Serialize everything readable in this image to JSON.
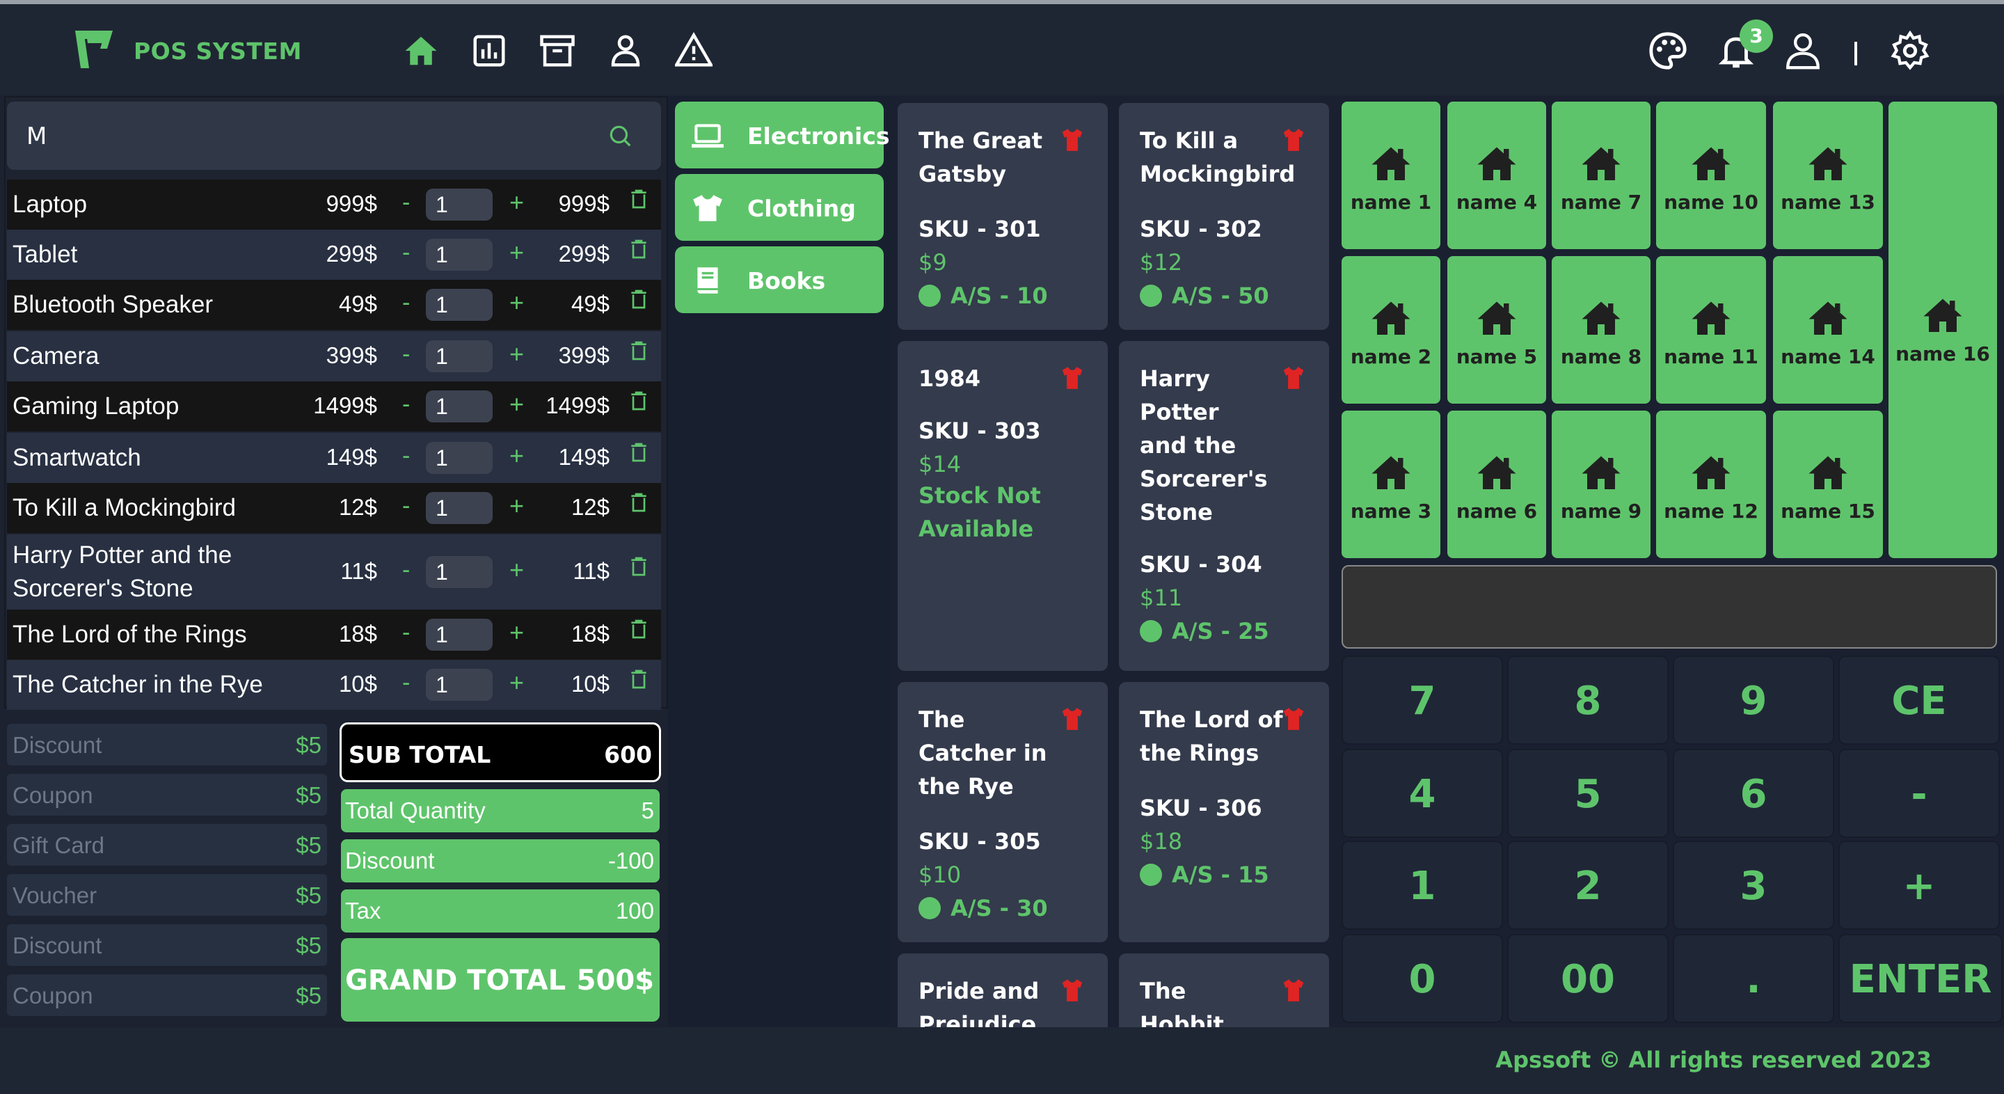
{
  "header": {
    "brand": "POS SYSTEM",
    "notification_count": "3"
  },
  "nav_icons": [
    "home-icon",
    "chart-icon",
    "archive-icon",
    "user-icon",
    "warning-icon"
  ],
  "right_icons": [
    "palette-icon",
    "bell-icon",
    "user-icon",
    "gear-icon"
  ],
  "search": {
    "value": "M"
  },
  "cart": [
    {
      "name": "Laptop",
      "price": "999$",
      "qty": "1",
      "total": "999$"
    },
    {
      "name": "Tablet",
      "price": "299$",
      "qty": "1",
      "total": "299$"
    },
    {
      "name": "Bluetooth Speaker",
      "price": "49$",
      "qty": "1",
      "total": "49$"
    },
    {
      "name": "Camera",
      "price": "399$",
      "qty": "1",
      "total": "399$"
    },
    {
      "name": "Gaming Laptop",
      "price": "1499$",
      "qty": "1",
      "total": "1499$"
    },
    {
      "name": "Smartwatch",
      "price": "149$",
      "qty": "1",
      "total": "149$"
    },
    {
      "name": "To Kill a Mockingbird",
      "price": "12$",
      "qty": "1",
      "total": "12$"
    },
    {
      "name": "Harry Potter and the Sorcerer's Stone",
      "price": "11$",
      "qty": "1",
      "total": "11$"
    },
    {
      "name": "The Lord of the Rings",
      "price": "18$",
      "qty": "1",
      "total": "18$"
    },
    {
      "name": "The Catcher in the Rye",
      "price": "10$",
      "qty": "1",
      "total": "10$"
    }
  ],
  "cart_symbols": {
    "minus": "-",
    "plus": "+"
  },
  "discounts": [
    {
      "label": "Discount",
      "value": "$5"
    },
    {
      "label": "Coupon",
      "value": "$5"
    },
    {
      "label": "Gift Card",
      "value": "$5"
    },
    {
      "label": "Voucher",
      "value": "$5"
    },
    {
      "label": "Discount",
      "value": "$5"
    },
    {
      "label": "Coupon",
      "value": "$5"
    }
  ],
  "summary": {
    "sub_total_label": "SUB TOTAL",
    "sub_total": "600",
    "qty_label": "Total Quantity",
    "qty": "5",
    "discount_label": "Discount",
    "discount": "-100",
    "tax_label": "Tax",
    "tax": "100",
    "grand_label": "GRAND TOTAL",
    "grand": "500$"
  },
  "categories": [
    {
      "label": "Electronics",
      "icon": "laptop-icon"
    },
    {
      "label": "Clothing",
      "icon": "shirt-icon"
    },
    {
      "label": "Books",
      "icon": "book-icon"
    }
  ],
  "products": [
    {
      "title": "The Great Gatsby",
      "sku": "SKU - 301",
      "price": "$9",
      "stock": "A/S - 10"
    },
    {
      "title": "To Kill a Mockingbird",
      "sku": "SKU - 302",
      "price": "$12",
      "stock": "A/S - 50"
    },
    {
      "title": "1984",
      "sku": "SKU - 303",
      "price": "$14",
      "stock": "Stock Not Available"
    },
    {
      "title": "Harry Potter and the Sorcerer's Stone",
      "sku": "SKU - 304",
      "price": "$11",
      "stock": "A/S - 25"
    },
    {
      "title": "The Catcher in the Rye",
      "sku": "SKU - 305",
      "price": "$10",
      "stock": "A/S - 30"
    },
    {
      "title": "The Lord of the Rings",
      "sku": "SKU - 306",
      "price": "$18",
      "stock": "A/S - 15"
    },
    {
      "title": "Pride and Prejudice"
    },
    {
      "title": "The Hobbit"
    }
  ],
  "quick_tiles": [
    "name 1",
    "name 2",
    "name 3",
    "name 4",
    "name 5",
    "name 6",
    "name 7",
    "name 8",
    "name 9",
    "name 10",
    "name 11",
    "name 12",
    "name 13",
    "name 14",
    "name 15",
    "name 16"
  ],
  "keypad": [
    "7",
    "8",
    "9",
    "CE",
    "4",
    "5",
    "6",
    "-",
    "1",
    "2",
    "3",
    "+",
    "0",
    "00",
    ".",
    "ENTER"
  ],
  "footer": "Apssoft © All rights reserved 2023",
  "colors": {
    "accent": "#5ec46b",
    "background": "#1c2230",
    "card": "#343b4c",
    "danger": "#e02424"
  }
}
